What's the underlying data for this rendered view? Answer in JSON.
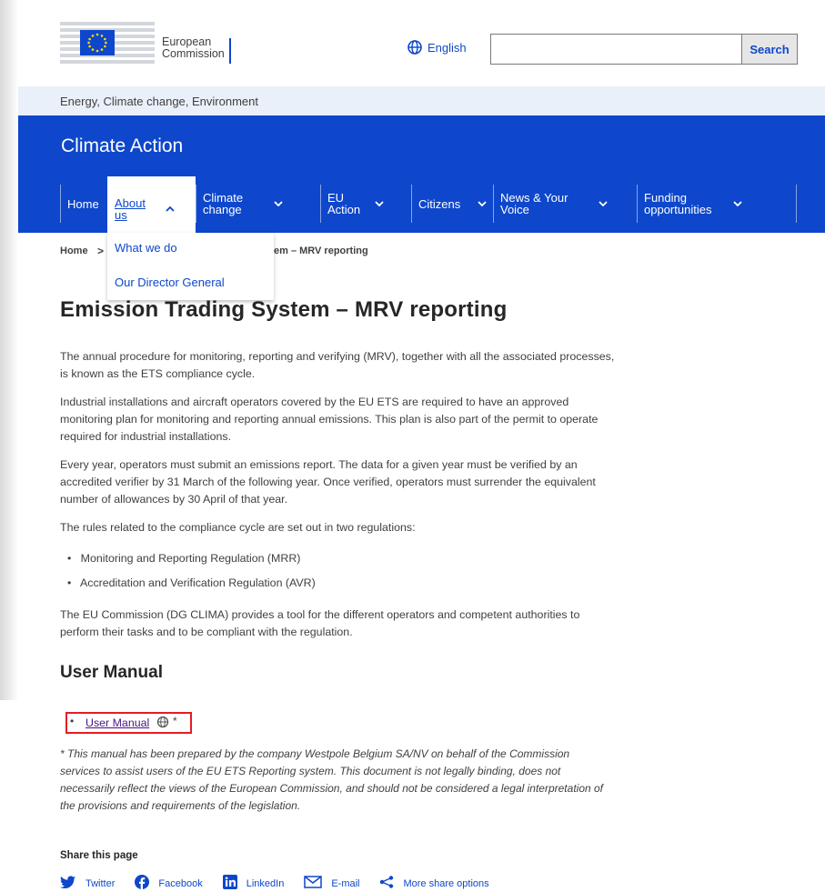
{
  "header": {
    "logo_line1": "European",
    "logo_line2": "Commission",
    "language": "English",
    "search_value": "",
    "search_button": "Search"
  },
  "site_bar": "Energy, Climate change, Environment",
  "site_title": "Climate Action",
  "nav": [
    {
      "label": "Home",
      "chevron": ""
    },
    {
      "label": "About us",
      "chevron": "^"
    },
    {
      "label": "Climate change",
      "chevron": "v"
    },
    {
      "label": "EU Action",
      "chevron": "v"
    },
    {
      "label": "Citizens",
      "chevron": "v"
    },
    {
      "label": "News & Your Voice",
      "chevron": "v"
    },
    {
      "label": "Funding opportunities",
      "chevron": "v"
    }
  ],
  "dropdown": [
    "What we do",
    "Our Director General"
  ],
  "breadcrumb": {
    "home": "Home",
    "sep": ">",
    "current": "em – MRV reporting"
  },
  "page": {
    "title": "Emission Trading System – MRV reporting",
    "paragraphs": [
      "The annual procedure for monitoring, reporting and verifying (MRV), together with all the associated processes, is known as the ETS compliance cycle.",
      "Industrial installations and aircraft operators covered by the EU ETS are required to have an approved monitoring plan for monitoring and reporting annual emissions. This plan is also part of the permit to operate required for industrial installations.",
      "Every year, operators must submit an emissions report. The data for a given year must be verified by an accredited verifier by 31 March of the following year. Once verified, operators must surrender the equivalent number of allowances by 30 April of that year.",
      "The rules related to the compliance cycle are set out in two regulations:"
    ],
    "bullets": [
      "Monitoring and Reporting Regulation (MRR)",
      "Accreditation and Verification Regulation (AVR)"
    ],
    "paragraph_after": "The EU Commission (DG CLIMA) provides a tool for the different operators and competent authorities to perform their tasks and to be compliant with the regulation.",
    "section_title": "User Manual",
    "manual_link": "User Manual",
    "manual_suffix": "*",
    "note": "* This manual has been prepared by the company Westpole Belgium SA/NV on behalf of the Commission services to assist users of the EU ETS Reporting system. This document is not legally binding, does not necessarily reflect the views of the European Commission, and should not be considered a legal interpretation of the provisions and requirements of the legislation."
  },
  "share": {
    "title": "Share this page",
    "items": [
      "Twitter",
      "Facebook",
      "LinkedIn",
      "E-mail",
      "More share options"
    ]
  },
  "colors": {
    "primary": "#0e47cb",
    "highlight": "#e51c23",
    "visited": "#4a148c"
  }
}
